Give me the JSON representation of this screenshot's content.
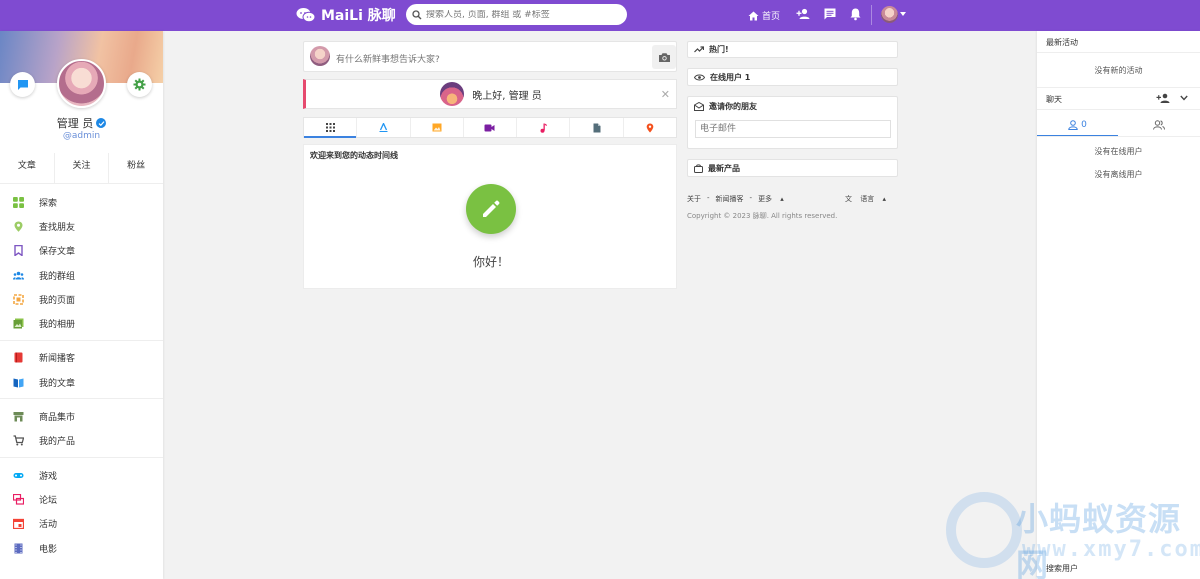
{
  "header": {
    "brand": "MaiLi 脉聊",
    "search_placeholder": "搜索人员, 页面, 群组 或 #标签",
    "home_label": "首页"
  },
  "profile": {
    "name": "管理 员",
    "handle": "@admin",
    "stats": [
      "文章",
      "关注",
      "粉丝"
    ]
  },
  "sidebar": {
    "group1": [
      {
        "label": "探索",
        "color": "#7ac142"
      },
      {
        "label": "查找朋友",
        "color": "#9ccc65"
      },
      {
        "label": "保存文章",
        "color": "#7e57c2"
      },
      {
        "label": "我的群组",
        "color": "#1e88e5"
      },
      {
        "label": "我的页面",
        "color": "#f4a640"
      },
      {
        "label": "我的相册",
        "color": "#8bc34a"
      }
    ],
    "group2": [
      {
        "label": "新闻播客",
        "color": "#e53935"
      },
      {
        "label": "我的文章",
        "color": "#1565c0"
      }
    ],
    "group3": [
      {
        "label": "商品集市",
        "color": "#6d8b57"
      },
      {
        "label": "我的产品",
        "color": "#555555"
      }
    ],
    "group4": [
      {
        "label": "游戏",
        "color": "#03a9f4"
      },
      {
        "label": "论坛",
        "color": "#e91e63"
      },
      {
        "label": "活动",
        "color": "#f44336"
      },
      {
        "label": "电影",
        "color": "#5c6bc0"
      }
    ]
  },
  "composer": {
    "placeholder": "有什么新鲜事想告诉大家?"
  },
  "greeting": {
    "text": "晚上好, 管理 员"
  },
  "timeline": {
    "title": "欢迎来到您的动态时间线",
    "hello": "你好！"
  },
  "widgets": {
    "hot": "热门!",
    "online": "在线用户 1",
    "invite_title": "邀请你的朋友",
    "invite_placeholder": "电子邮件",
    "products": "最新产品"
  },
  "footer": {
    "links": [
      "关于",
      "-",
      "新闻播客",
      "-",
      "更多"
    ],
    "language": "语言",
    "copyright": "Copyright © 2023 脉聊. All rights reserved."
  },
  "rightrail": {
    "activity_title": "最新活动",
    "activity_empty": "没有新的活动",
    "chat_title": "聊天",
    "online_count": "0",
    "no_online": "没有在线用户",
    "no_offline": "没有离线用户",
    "search_users": "搜索用户"
  },
  "watermark": {
    "title": "小蚂蚁资源网",
    "sub": "www.xmy7.com"
  },
  "colors": {
    "brand": "#7f4bd1",
    "accent_blue": "#3b82e0",
    "pencil_green": "#7ac142",
    "greet_border": "#e64a6e"
  }
}
